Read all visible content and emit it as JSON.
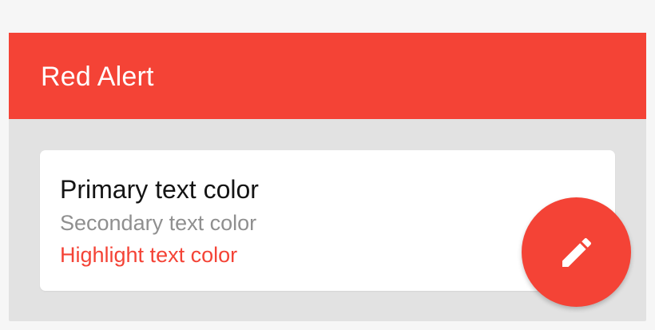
{
  "app_bar": {
    "title": "Red Alert"
  },
  "card": {
    "primary_text": "Primary text color",
    "secondary_text": "Secondary text color",
    "highlight_text": "Highlight text color"
  },
  "fab": {
    "icon": "pencil-icon"
  },
  "colors": {
    "primary": "#f44336",
    "background": "#e2e2e2",
    "page_background": "#f6f6f6",
    "card_background": "#ffffff",
    "primary_text": "#141414",
    "secondary_text": "#8f8f8f",
    "highlight_text": "#f44336"
  }
}
